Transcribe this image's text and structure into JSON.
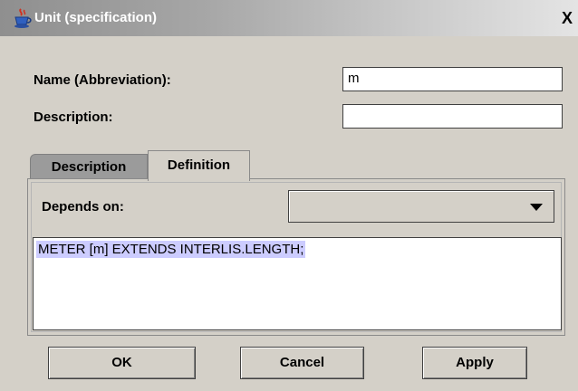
{
  "window": {
    "title": "Unit (specification)",
    "close_glyph": "X",
    "icon": "java-cup-icon"
  },
  "form": {
    "name_label": "Name (Abbreviation):",
    "name_value": "m",
    "description_label": "Description:",
    "description_value": ""
  },
  "tabs": [
    {
      "label": "Description",
      "active": false
    },
    {
      "label": "Definition",
      "active": true
    }
  ],
  "definition": {
    "depends_on_label": "Depends on:",
    "depends_on_value": "",
    "text": "METER [m] EXTENDS INTERLIS.LENGTH;"
  },
  "buttons": {
    "ok": "OK",
    "cancel": "Cancel",
    "apply": "Apply"
  },
  "colors": {
    "selection": "#ccccff",
    "background": "#d4d0c8"
  }
}
